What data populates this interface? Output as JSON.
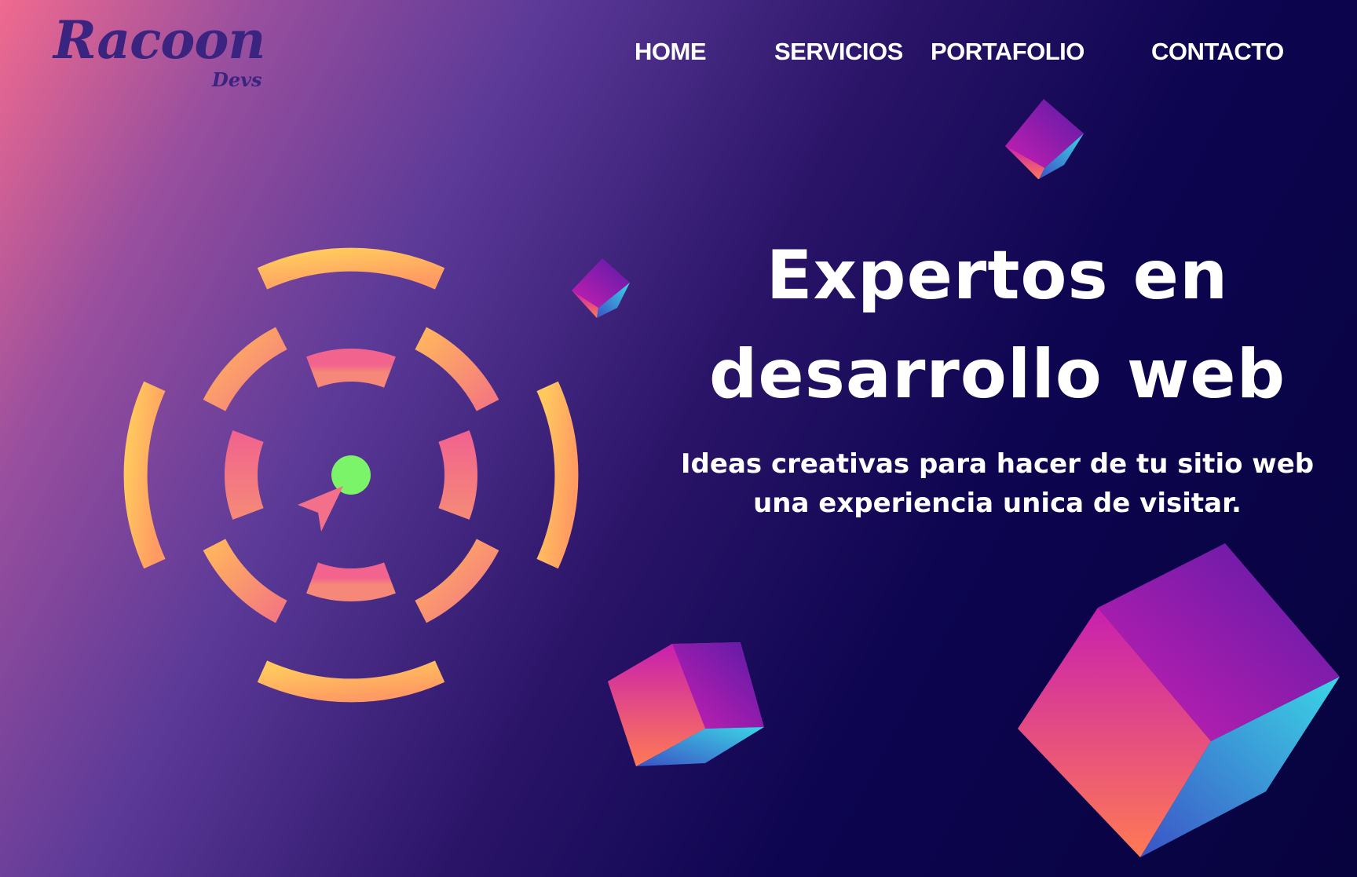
{
  "brand": {
    "name": "Racoon",
    "tagline": "Devs"
  },
  "nav": {
    "home": "HOME",
    "services": "SERVICIOS",
    "portfolio": "PORTAFOLIO",
    "contact": "CONTACTO"
  },
  "hero": {
    "title_line1": "Expertos en",
    "title_line2": "desarrollo web",
    "subtitle_line1": "Ideas creativas para hacer de tu sitio web",
    "subtitle_line2": "una experiencia unica de visitar."
  },
  "colors": {
    "brand": "#3a2480",
    "ring_orange": "#ffb65c",
    "ring_pink": "#f2708a",
    "center_dot": "#7cf46a",
    "cube_magenta": "#c81fb0",
    "cube_cyan": "#38d3e8"
  },
  "icons": [
    "target-rings-icon",
    "cursor-arrow-icon",
    "cube-icon"
  ]
}
